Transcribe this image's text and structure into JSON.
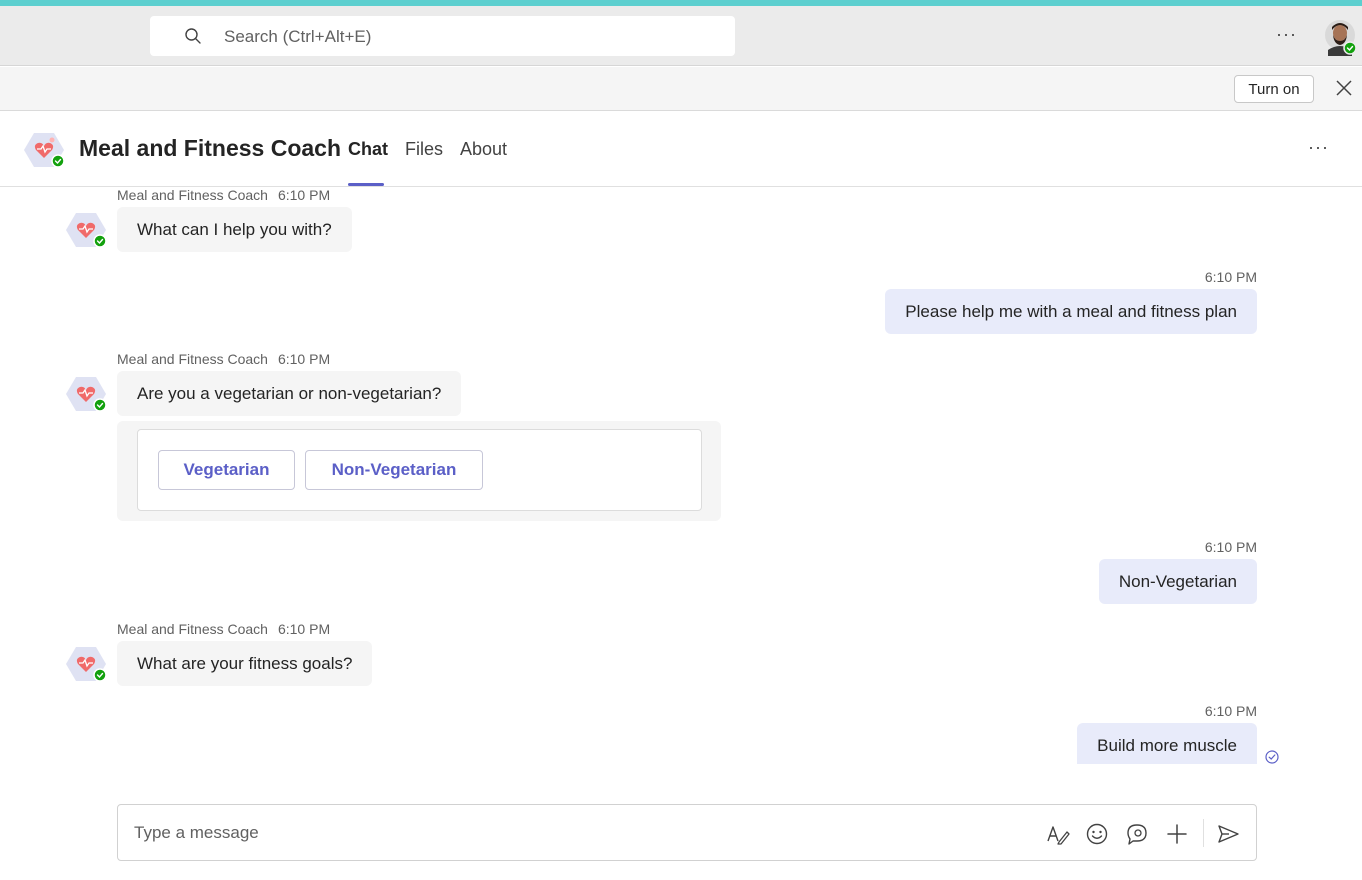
{
  "titlebar": {
    "search_placeholder": "Search (Ctrl+Alt+E)",
    "more_label": "···"
  },
  "banner": {
    "turn_on_label": "Turn on"
  },
  "header": {
    "app_name": "Meal and Fitness Coach",
    "tabs": [
      {
        "label": "Chat",
        "active": true
      },
      {
        "label": "Files",
        "active": false
      },
      {
        "label": "About",
        "active": false
      }
    ],
    "more_label": "···"
  },
  "messages": [
    {
      "from": "bot",
      "sender": "Meal and Fitness Coach",
      "time": "6:10 PM",
      "text": "What can I help you with?"
    },
    {
      "from": "me",
      "time": "6:10 PM",
      "text": "Please help me with a meal and fitness plan"
    },
    {
      "from": "bot",
      "sender": "Meal and Fitness Coach",
      "time": "6:10 PM",
      "text": "Are you a vegetarian or non-vegetarian?",
      "card_buttons": [
        "Vegetarian",
        "Non-Vegetarian"
      ]
    },
    {
      "from": "me",
      "time": "6:10 PM",
      "text": "Non-Vegetarian"
    },
    {
      "from": "bot",
      "sender": "Meal and Fitness Coach",
      "time": "6:10 PM",
      "text": "What are your fitness goals?"
    },
    {
      "from": "me",
      "time": "6:10 PM",
      "text": "Build more muscle"
    }
  ],
  "composer": {
    "placeholder": "Type a message"
  },
  "colors": {
    "accent": "#5b5fc7",
    "top_strip": "#5ccfcf",
    "my_bubble": "#e8ebfa",
    "bot_bubble": "#f5f5f5",
    "presence": "#13a10e"
  }
}
